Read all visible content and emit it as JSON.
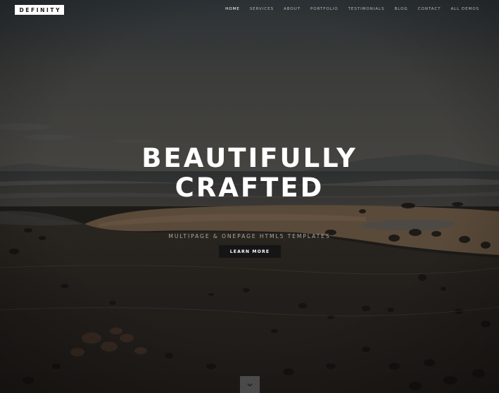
{
  "header": {
    "logo_text": "DEFINITY",
    "nav": [
      {
        "label": "HOME"
      },
      {
        "label": "SERVICES"
      },
      {
        "label": "ABOUT"
      },
      {
        "label": "PORTFOLIO"
      },
      {
        "label": "TESTIMONIALS"
      },
      {
        "label": "BLOG"
      },
      {
        "label": "CONTACT"
      },
      {
        "label": "ALL DEMOS"
      }
    ],
    "active_item": "HOME"
  },
  "hero": {
    "title_line1": "BEAUTIFULLY",
    "title_line2": "CRAFTED",
    "subtitle": "MULTIPAGE & ONEPAGE HTML5 TEMPLATES",
    "cta_label": "LEARN MORE",
    "scroll_icon": "chevron-down-icon"
  },
  "colors": {
    "accent_text": "#ffffff",
    "nav_text": "#b4b7b9",
    "button_bg": "#151515",
    "scroll_button_bg": "#4a4a4a"
  }
}
